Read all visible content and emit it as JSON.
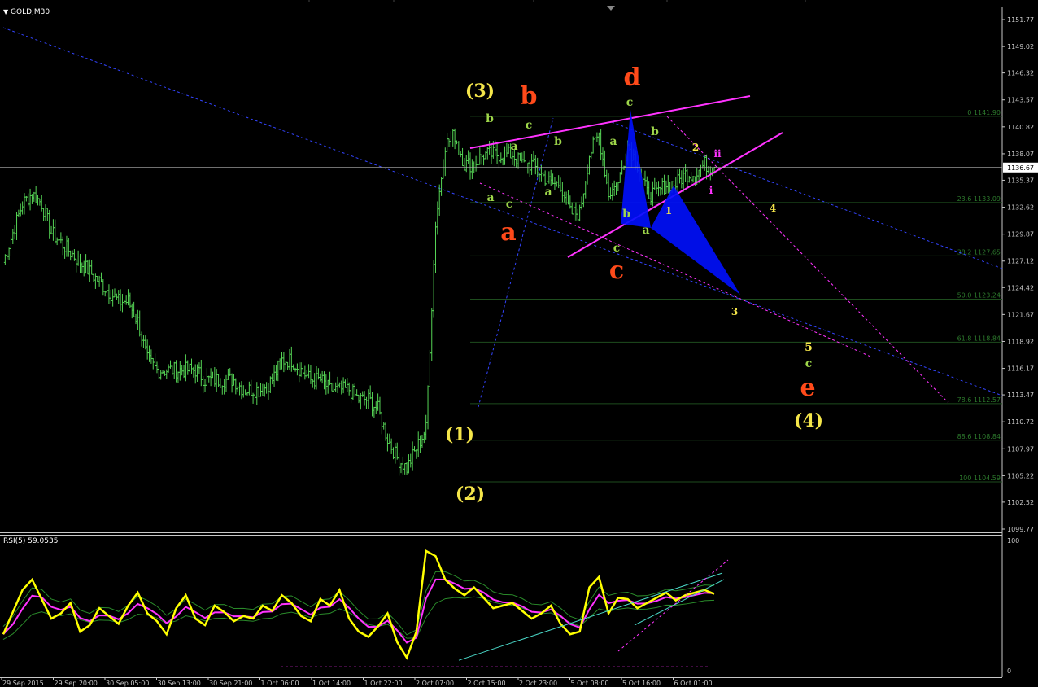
{
  "header": {
    "symbol": "GOLD,M30",
    "indicator": "RSI(5) 59.0535"
  },
  "colors": {
    "background": "#000000",
    "candles": "#55d455",
    "rsi_line": "#ffff00",
    "rsi_signal": "#ff33ff",
    "wedge": "#ff33ff",
    "triangle": "#0010ff",
    "trend_dashed": "#3344ff",
    "fib_lines": "#1e4d1e",
    "wave_yellow": "#f5e64a",
    "wave_red": "#ff4a1a",
    "wave_green": "#9ed64a"
  },
  "chart_data": {
    "type": "line",
    "title": "GOLD,M30",
    "y_axis_labels": [
      "1151.77",
      "1149.02",
      "1146.32",
      "1143.57",
      "1140.82",
      "1138.07",
      "1135.37",
      "1132.62",
      "1129.87",
      "1127.12",
      "1124.42",
      "1121.67",
      "1118.92",
      "1116.17",
      "1113.47",
      "1110.72",
      "1107.97",
      "1105.22",
      "1102.52",
      "1099.77"
    ],
    "ylim": [
      1099.77,
      1151.77
    ],
    "current_price": "1136.67",
    "time_labels": [
      "29 Sep 2015",
      "29 Sep 20:00",
      "30 Sep 05:00",
      "30 Sep 13:00",
      "30 Sep 21:00",
      "1 Oct 06:00",
      "1 Oct 14:00",
      "1 Oct 22:00",
      "2 Oct 07:00",
      "2 Oct 15:00",
      "2 Oct 23:00",
      "5 Oct 08:00",
      "5 Oct 16:00",
      "6 Oct 01:00"
    ],
    "series": [
      {
        "values": [
          1127,
          1130,
          1133,
          1134,
          1133,
          1130,
          1129,
          1128,
          1127,
          1126,
          1125,
          1124,
          1123,
          1123,
          1121,
          1117,
          1116,
          1116,
          1116,
          1116,
          1116,
          1115,
          1115,
          1115,
          1115,
          1114,
          1114,
          1114,
          1115,
          1117,
          1117,
          1116,
          1115,
          1115,
          1114,
          1114,
          1114,
          1113,
          1113,
          1112,
          1109,
          1107,
          1106,
          1108,
          1110,
          1131,
          1139,
          1140,
          1137,
          1137,
          1138,
          1138,
          1138,
          1138,
          1137,
          1137,
          1136,
          1135,
          1135,
          1132,
          1132,
          1138,
          1140,
          1134,
          1135,
          1139,
          1137,
          1134,
          1134,
          1135,
          1135,
          1136,
          1136,
          1137,
          1136.7
        ]
      }
    ],
    "fib_levels": [
      {
        "label": "0 1141.90",
        "value": 1141.9
      },
      {
        "label": "23.6 1133.09",
        "value": 1133.09
      },
      {
        "label": "38.2 1127.65",
        "value": 1127.65
      },
      {
        "label": "50.0 1123.24",
        "value": 1123.24
      },
      {
        "label": "61.8 1118.84",
        "value": 1118.84
      },
      {
        "label": "78.6 1112.57",
        "value": 1112.57
      },
      {
        "label": "88.6 1108.84",
        "value": 1108.84
      },
      {
        "label": "100 1104.59",
        "value": 1104.59
      }
    ],
    "wave_labels": [
      "(1)",
      "(2)",
      "(3)",
      "(4)",
      "a",
      "b",
      "c",
      "d",
      "e",
      "1",
      "2",
      "3",
      "4",
      "5",
      "i",
      "ii"
    ],
    "rsi": {
      "name": "RSI(5)",
      "last_value": 59.0535,
      "ylim": [
        0,
        100
      ],
      "axis_labels": [
        "100",
        "0"
      ],
      "values": [
        28,
        45,
        62,
        70,
        55,
        40,
        44,
        52,
        30,
        35,
        48,
        42,
        36,
        50,
        60,
        44,
        38,
        28,
        48,
        58,
        40,
        35,
        50,
        45,
        38,
        42,
        40,
        50,
        46,
        58,
        52,
        42,
        38,
        55,
        50,
        62,
        40,
        30,
        26,
        34,
        44,
        22,
        10,
        30,
        92,
        88,
        70,
        63,
        58,
        64,
        56,
        48,
        50,
        52,
        46,
        40,
        44,
        50,
        36,
        28,
        30,
        64,
        72,
        44,
        56,
        55,
        48,
        52,
        56,
        60,
        54,
        58,
        60,
        62,
        59
      ]
    }
  }
}
